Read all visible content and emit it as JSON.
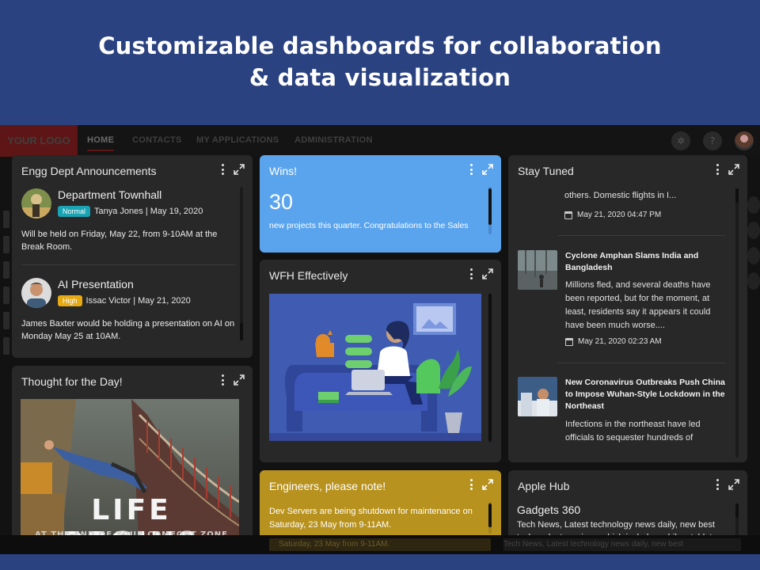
{
  "hero": {
    "title_line1": "Customizable dashboards for collaboration",
    "title_line2": "& data visualization"
  },
  "nav": {
    "logo": "YOUR LOGO",
    "items": [
      "HOME",
      "CONTACTS",
      "MY APPLICATIONS",
      "ADMINISTRATION"
    ],
    "active": "HOME",
    "icons": [
      "settings-icon",
      "help-icon",
      "user-avatar"
    ]
  },
  "announcements": {
    "title": "Engg Dept Announcements",
    "items": [
      {
        "heading": "Department Townhall",
        "badge": "Normal",
        "badge_color": "#1aa3b3",
        "meta": "Tanya Jones | May 19, 2020",
        "body": "Will be held on Friday, May 22, from 9-10AM at the Break Room."
      },
      {
        "heading": "AI Presentation",
        "badge": "High",
        "badge_color": "#e6ab12",
        "meta": "Issac Victor | May 21, 2020",
        "body": "James Baxter would be holding a presentation on AI on Monday May 25 at 10AM."
      }
    ]
  },
  "thought": {
    "title": "Thought for the Day!",
    "caption": "LIFE BEGINS",
    "caption_sub": "AT THE END OF YOUR COMFORT ZONE"
  },
  "wins": {
    "title": "Wins!",
    "number": "30",
    "text": "new projects this quarter. Congratulations to the Sales",
    "color": "#5aa4ee"
  },
  "wfh": {
    "title": "WFH Effectively"
  },
  "engineers": {
    "title": "Engineers, please note!",
    "body": "Dev Servers are being shutdown for maintenance on Saturday, 23 May from 9-11AM.",
    "color": "#b8921e"
  },
  "stay_tuned": {
    "title": "Stay Tuned",
    "top_snippet": "others. Domestic flights in I...",
    "top_date": "May 21, 2020 04:47 PM",
    "items": [
      {
        "title": "Cyclone Amphan Slams India and Bangladesh",
        "body": "Millions fled, and several deaths have been reported, but for the moment, at least, residents say it appears it could have been much worse....",
        "date": "May 21, 2020 02:23 AM"
      },
      {
        "title": "New Coronavirus Outbreaks Push China to Impose Wuhan-Style Lockdown in the Northeast",
        "body": "Infections in the northeast have led officials to sequester hundreds of"
      }
    ]
  },
  "apple_hub": {
    "title": "Apple Hub",
    "heading": "Gadgets 360",
    "body": "Tech News, Latest technology news daily, new best tech gadgets reviews which include mobiles, tablets"
  },
  "bottom_ghost": {
    "left": "Saturday, 23 May from 9-11AM.",
    "right": "Tech News, Latest technology news daily, new best"
  }
}
